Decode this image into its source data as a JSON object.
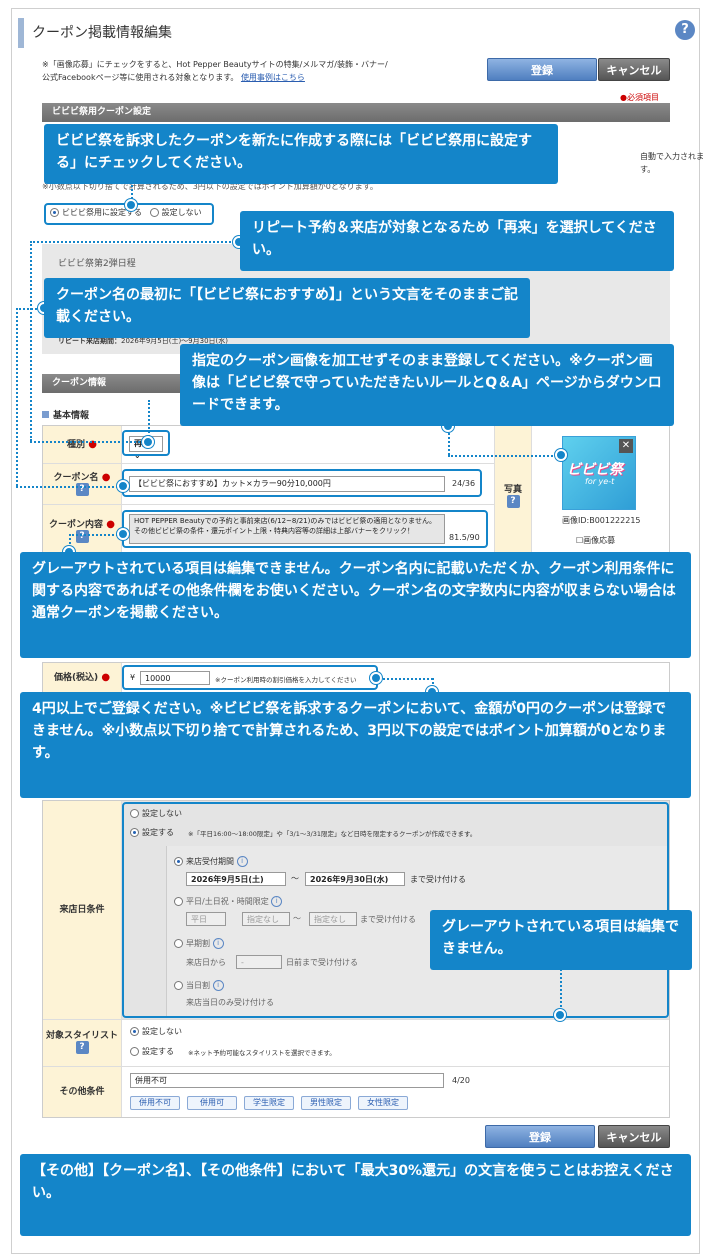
{
  "header": {
    "title": "クーポン掲載情報編集",
    "help": "?"
  },
  "buttons": {
    "register": "登録",
    "cancel": "キャンセル"
  },
  "notes": {
    "top_line1": "※「画像応募」にチェックをすると、Hot Pepper Beautyサイトの特集/メルマガ/装飾・バナー/",
    "top_line2": "公式Facebookページ等に使用される対象となります。",
    "example_link": "使用事例はこちら",
    "required": "●必須項目"
  },
  "sections": {
    "bibibi": "ビビビ祭用クーポン設定",
    "coupon_info": "クーポン情報",
    "basic_info": "基本情報"
  },
  "bibibi": {
    "partial_right": "自動で入力されます。",
    "partial_line": "※小数点以下切り捨てで計算されるため、3円以下の設定ではポイント加算額が0となります。",
    "opt_set": "ビビビ祭用に設定する",
    "opt_not": "設定しない",
    "round2": "ビビビ祭第2弾日程",
    "repeat_label": "リピート来店期間：",
    "repeat_value": "2026年9月5日(土)〜9月30日(水)"
  },
  "form": {
    "type_label": "種別",
    "type_value": "再来",
    "name_label": "クーポン名",
    "name_value": "【ビビビ祭におすすめ】カット×カラー90分10,000円",
    "name_count": "24/36",
    "content_label": "クーポン内容",
    "content_value": "HOT PEPPER Beautyでの予約と事前来店(6/12~8/21)のみではビビビ祭の適用となりません。その他ビビビ祭の条件・還元ポイント上限・特典内容等の詳細は上部バナーをクリック！",
    "content_count": "81.5/90",
    "photo_label": "写真",
    "image_id": "画像ID:B001222215",
    "image_apply": "画像応募",
    "thumb_text": "ビビビ祭",
    "thumb_sub": "for ye-t",
    "price_label": "価格(税込)",
    "price_yen": "¥",
    "price_value": "10000",
    "price_note": "※クーポン利用時の割引価格を入力してください",
    "visit_label": "来店日条件",
    "visit_not": "設定しない",
    "visit_set": "設定する",
    "visit_note": "※「平日16:00〜18:00限定」や「3/1〜3/31限定」など日時を限定するクーポンが作成できます。",
    "accept_period": "来店受付期間",
    "date_from": "2026年9月5日(土)",
    "date_to": "2026年9月30日(水)",
    "tilde": "〜",
    "accept_suffix": "まで受け付ける",
    "weekday_label": "平日/土日祝・時間限定",
    "weekday_sel": "平日",
    "time_from": "指定なし",
    "time_to": "指定なし",
    "weekday_suffix": "まで受け付ける",
    "early_label": "早期割",
    "early_from": "来店日から",
    "early_sel": "-",
    "early_suffix": "日前まで受け付ける",
    "sameday_label": "当日割",
    "sameday_note": "来店当日のみ受け付ける",
    "stylist_label": "対象スタイリスト",
    "stylist_not": "設定しない",
    "stylist_set": "設定する",
    "stylist_note": "※ネット予約可能なスタイリストを選択できます。",
    "other_label": "その他条件",
    "other_value": "併用不可",
    "other_count": "4/20",
    "tags": [
      "併用不可",
      "併用可",
      "学生限定",
      "男性限定",
      "女性限定"
    ]
  },
  "callouts": {
    "c1": "ビビビ祭を訴求したクーポンを新たに作成する際には「ビビビ祭用に設定する」にチェックしてください。",
    "c2": "リピート予約＆来店が対象となるため「再来」を選択してください。",
    "c3": "クーポン名の最初に「【ビビビ祭におすすめ】」という文言をそのままご記載ください。",
    "c4": "指定のクーポン画像を加工せずそのまま登録してください。※クーポン画像は「ビビビ祭で守っていただきたいルールとQ＆A」ページからダウンロードできます。",
    "c5": "グレーアウトされている項目は編集できません。クーポン名内に記載いただくか、クーポン利用条件に関する内容であればその他条件欄をお使いください。クーポン名の文字数内に内容が収まらない場合は通常クーポンを掲載ください。",
    "c6": "4円以上でご登録ください。※ビビビ祭を訴求するクーポンにおいて、金額が0円のクーポンは登録できません。※小数点以下切り捨てで計算されるため、3円以下の設定ではポイント加算額が0となります。",
    "c7": "グレーアウトされている項目は編集できません。",
    "c8": "【その他】【クーポン名】、【その他条件】において「最大30%還元」の文言を使うことはお控えください。"
  },
  "colors": {
    "callout": "#1485c9",
    "label_bg": "#fdf3d6",
    "required": "#cc0000"
  }
}
